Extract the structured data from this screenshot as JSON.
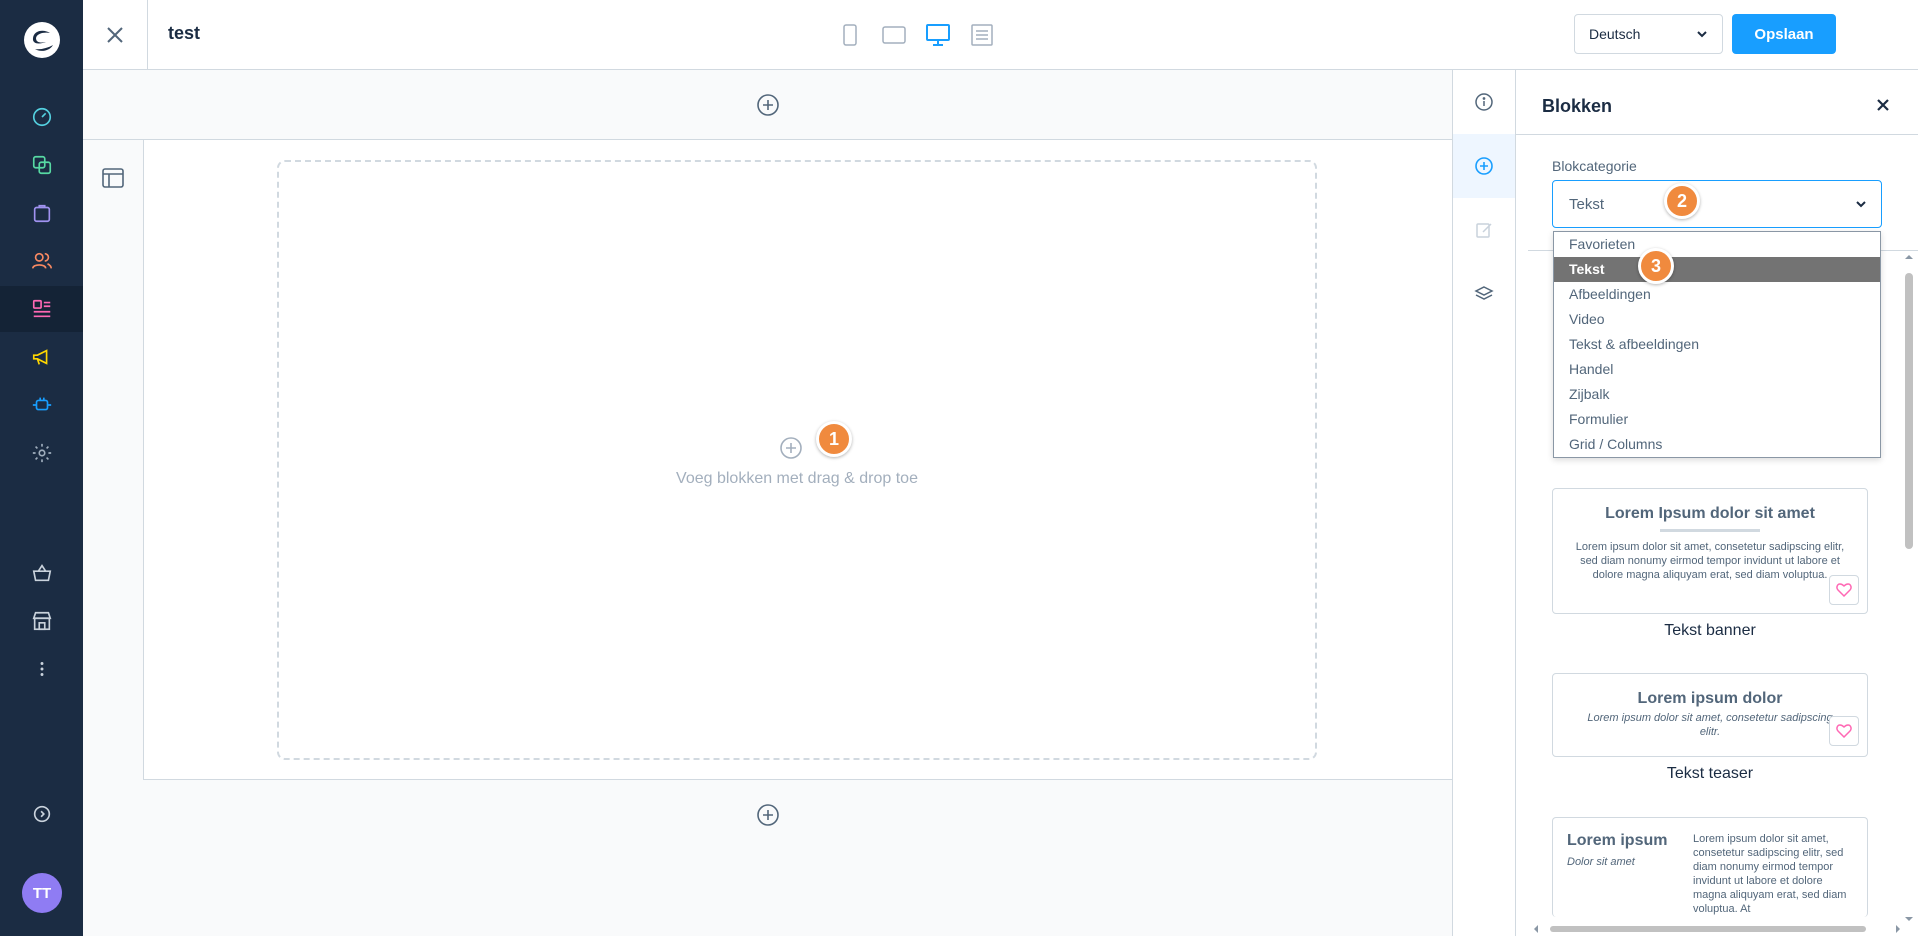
{
  "topbar": {
    "page_name": "test",
    "language": "Deutsch",
    "save_label": "Opslaan"
  },
  "canvas": {
    "dropzone_text": "Voeg blokken met drag & drop toe"
  },
  "callouts": [
    "1",
    "2",
    "3"
  ],
  "user": {
    "initials": "TT"
  },
  "panel": {
    "title": "Blokken",
    "category_label": "Blokcategorie",
    "category_value": "Tekst",
    "options": [
      "Favorieten",
      "Tekst",
      "Afbeeldingen",
      "Video",
      "Tekst & afbeeldingen",
      "Handel",
      "Zijbalk",
      "Formulier",
      "Grid / Columns"
    ],
    "blocks": [
      {
        "title": "Lorem Ipsum dolor sit amet",
        "text": "Lorem ipsum dolor sit amet, consetetur sadipscing elitr, sed diam nonumy eirmod tempor invidunt ut labore et dolore magna aliquyam erat, sed diam voluptua.",
        "caption": "Tekst banner"
      },
      {
        "title": "Lorem ipsum dolor",
        "text": "Lorem ipsum dolor sit amet, consetetur sadipscing elitr.",
        "caption": "Tekst teaser"
      },
      {
        "title": "Lorem ipsum",
        "subtitle": "Dolor sit amet",
        "text": "Lorem ipsum dolor sit amet, consetetur sadipscing elitr, sed diam nonumy eirmod tempor invidunt ut labore et dolore magna aliquyam erat, sed diam voluptua. At"
      }
    ]
  },
  "colors": {
    "accent": "#189eff",
    "nav": "#1b2c43",
    "callout": "#f08a3e",
    "selected_option": "#737373"
  },
  "icons": {
    "nav": [
      "dashboard-icon",
      "catalog-icon",
      "orders-icon",
      "customers-icon",
      "content-icon",
      "marketing-icon",
      "extensions-icon",
      "settings-icon",
      "sales-channel-icon",
      "storefront-icon",
      "more-icon",
      "expand-icon"
    ],
    "devices": [
      "mobile-icon",
      "tablet-icon",
      "desktop-icon",
      "list-view-icon"
    ],
    "tabs": [
      "info-icon",
      "add-block-icon",
      "edit-icon",
      "layers-icon"
    ]
  }
}
